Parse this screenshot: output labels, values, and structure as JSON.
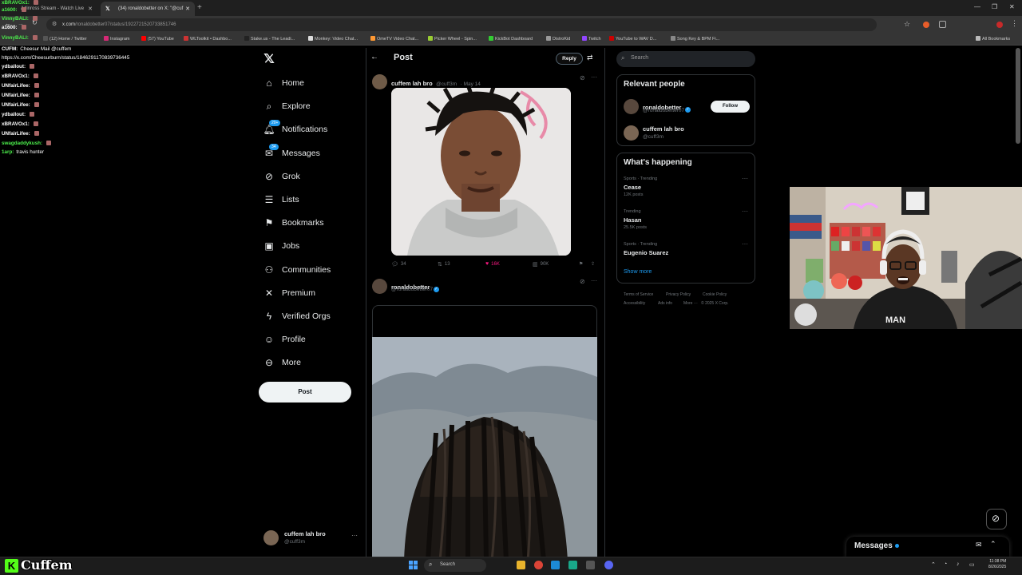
{
  "browser": {
    "tabs": [
      {
        "label": "Adinross Stream - Watch Live"
      },
      {
        "label": "(34) ronaldobetter on X: \"@cuf"
      }
    ],
    "url_prefix": "x.com",
    "url_rest": "/ronaldobetter07/status/1922721520733851746",
    "bookmarks": [
      "(12) Home / Twitter",
      "Instagram",
      "(57) YouTube",
      "WLToolkit • Dashbo...",
      "Stake.us - The Leadi...",
      "Monkey: Video Chat...",
      "OmeTV Video Chat...",
      "Picker Wheel - Spin...",
      "KickBot Dashboard",
      "DistroKid",
      "Twitch",
      "YouTube to WAV D...",
      "Song Key & BPM Fi...",
      "All Bookmarks"
    ]
  },
  "chat": [
    {
      "name": "xBRAVOx1:",
      "text": "",
      "color": "#4cf04c"
    },
    {
      "name": "a1600:",
      "text": "",
      "color": "#4cf04c"
    },
    {
      "name": "VinnyBALI:",
      "text": "",
      "color": "#4cf04c"
    },
    {
      "name": "a1600:",
      "text": "",
      "color": "#ffffff"
    },
    {
      "name": "VinnyBALI:",
      "text": "",
      "color": "#4cf04c"
    },
    {
      "name": "CUFM:",
      "text": "Cheesur Mail @cuffem",
      "color": "#ffffff"
    },
    {
      "name": "",
      "text": "https://x.com/Cheesurburn/status/1846291170839736445",
      "color": "#ffffff"
    },
    {
      "name": "ydballout:",
      "text": "",
      "color": "#ffffff"
    },
    {
      "name": "xBRAVOx1:",
      "text": "",
      "color": "#ffffff"
    },
    {
      "name": "UNfairLifee:",
      "text": "",
      "color": "#ffffff"
    },
    {
      "name": "UNfairLifee:",
      "text": "",
      "color": "#ffffff"
    },
    {
      "name": "UNfairLifee:",
      "text": "",
      "color": "#ffffff"
    },
    {
      "name": "ydballout:",
      "text": "",
      "color": "#ffffff"
    },
    {
      "name": "xBRAVOx1:",
      "text": "",
      "color": "#ffffff"
    },
    {
      "name": "UNfairLifee:",
      "text": "",
      "color": "#ffffff"
    },
    {
      "name": "swagdaddykush:",
      "text": "",
      "color": "#4cf04c"
    },
    {
      "name": "1arp:",
      "text": "travis hunter",
      "color": "#4cf04c"
    }
  ],
  "nav": {
    "items": [
      {
        "label": "Home",
        "icon": "home-icon"
      },
      {
        "label": "Explore",
        "icon": "search-icon"
      },
      {
        "label": "Notifications",
        "icon": "bell-icon",
        "badge": "20+"
      },
      {
        "label": "Messages",
        "icon": "mail-icon",
        "badge": "34"
      },
      {
        "label": "Grok",
        "icon": "grok-icon"
      },
      {
        "label": "Lists",
        "icon": "list-icon"
      },
      {
        "label": "Bookmarks",
        "icon": "bookmark-icon"
      },
      {
        "label": "Jobs",
        "icon": "briefcase-icon"
      },
      {
        "label": "Communities",
        "icon": "people-icon"
      },
      {
        "label": "Premium",
        "icon": "x-icon"
      },
      {
        "label": "Verified Orgs",
        "icon": "lightning-icon"
      },
      {
        "label": "Profile",
        "icon": "person-icon"
      },
      {
        "label": "More",
        "icon": "more-circle-icon"
      }
    ],
    "post_button": "Post",
    "account_name": "cuffem lah bro",
    "account_handle": "@cuff3m"
  },
  "post": {
    "header_title": "Post",
    "reply_button": "Reply",
    "quoted": {
      "author": "cuffem lah bro",
      "handle": "@cuff3m",
      "date": "· May 14"
    },
    "actions": {
      "replies": "34",
      "reposts": "13",
      "likes": "16K",
      "views": "90K"
    },
    "main": {
      "author": "ronaldobetter",
      "handle": "@ronaldobetter07"
    }
  },
  "right": {
    "search_placeholder": "Search",
    "relevant_title": "Relevant people",
    "people": [
      {
        "name": "ronaldobetter",
        "handle": "@ronaldobetter07",
        "follow": "Follow"
      },
      {
        "name": "cuffem lah bro",
        "handle": "@cuff3m"
      }
    ],
    "happening_title": "What's happening",
    "trends": [
      {
        "category": "Sports · Trending",
        "name": "Cease",
        "posts": "12K posts"
      },
      {
        "category": "Trending",
        "name": "Hasan",
        "posts": "25.5K posts"
      },
      {
        "category": "Sports · Trending",
        "name": "Eugenio Suarez",
        "posts": ""
      }
    ],
    "show_more": "Show more",
    "footer": [
      "Terms of Service",
      "Privacy Policy",
      "Cookie Policy",
      "Accessibility",
      "Ads info",
      "More ···",
      "© 2025 X Corp."
    ]
  },
  "messages_dock": "Messages",
  "stream_logo": "Cuffem",
  "taskbar": {
    "search": "Search",
    "time": "11:38 PM",
    "date": "8/26/2025"
  },
  "colors": {
    "accent": "#1d9bf0",
    "like": "#f91880",
    "kick_green": "#53fc18"
  }
}
